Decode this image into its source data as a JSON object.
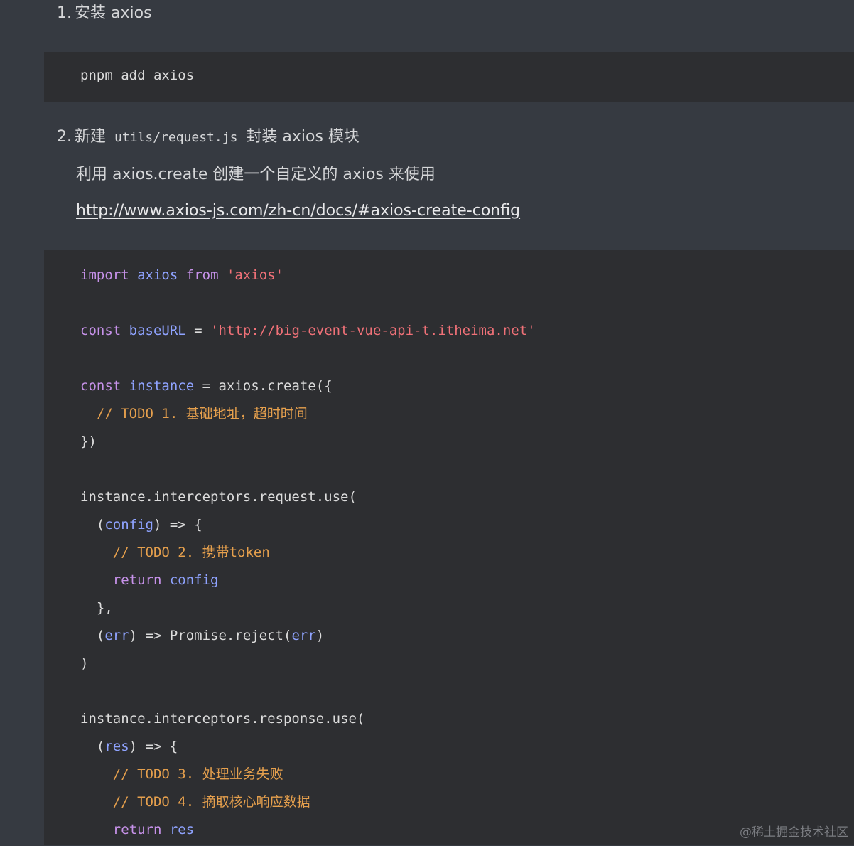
{
  "steps": [
    {
      "number": "1.",
      "text": "安装 axios"
    },
    {
      "number": "2.",
      "text_before": "新建",
      "code": "utils/request.js",
      "text_after": "封装 axios 模块"
    }
  ],
  "install_command": "pnpm add axios",
  "description": "利用 axios.create 创建一个自定义的 axios 来使用",
  "doc_link": "http://www.axios-js.com/zh-cn/docs/#axios-create-config",
  "code_lines": [
    [
      {
        "t": "import",
        "c": "kw"
      },
      {
        "t": " ",
        "c": "pl"
      },
      {
        "t": "axios",
        "c": "id"
      },
      {
        "t": " ",
        "c": "pl"
      },
      {
        "t": "from",
        "c": "kw"
      },
      {
        "t": " ",
        "c": "pl"
      },
      {
        "t": "'axios'",
        "c": "str"
      }
    ],
    [],
    [
      {
        "t": "const",
        "c": "kw"
      },
      {
        "t": " ",
        "c": "pl"
      },
      {
        "t": "baseURL",
        "c": "id"
      },
      {
        "t": " = ",
        "c": "pl"
      },
      {
        "t": "'http://big-event-vue-api-t.itheima.net'",
        "c": "str"
      }
    ],
    [],
    [
      {
        "t": "const",
        "c": "kw"
      },
      {
        "t": " ",
        "c": "pl"
      },
      {
        "t": "instance",
        "c": "id"
      },
      {
        "t": " = axios.create({",
        "c": "pl"
      }
    ],
    [
      {
        "t": "  // TODO 1. 基础地址，超时时间",
        "c": "cm"
      }
    ],
    [
      {
        "t": "})",
        "c": "pl"
      }
    ],
    [],
    [
      {
        "t": "instance.interceptors.request.use(",
        "c": "pl"
      }
    ],
    [
      {
        "t": "  (",
        "c": "pl"
      },
      {
        "t": "config",
        "c": "id"
      },
      {
        "t": ") => {",
        "c": "pl"
      }
    ],
    [
      {
        "t": "    // TODO 2. 携带token",
        "c": "cm"
      }
    ],
    [
      {
        "t": "    ",
        "c": "pl"
      },
      {
        "t": "return",
        "c": "kw"
      },
      {
        "t": " ",
        "c": "pl"
      },
      {
        "t": "config",
        "c": "id"
      }
    ],
    [
      {
        "t": "  },",
        "c": "pl"
      }
    ],
    [
      {
        "t": "  (",
        "c": "pl"
      },
      {
        "t": "err",
        "c": "id"
      },
      {
        "t": ") => Promise.reject(",
        "c": "pl"
      },
      {
        "t": "err",
        "c": "id"
      },
      {
        "t": ")",
        "c": "pl"
      }
    ],
    [
      {
        "t": ")",
        "c": "pl"
      }
    ],
    [],
    [
      {
        "t": "instance.interceptors.response.use(",
        "c": "pl"
      }
    ],
    [
      {
        "t": "  (",
        "c": "pl"
      },
      {
        "t": "res",
        "c": "id"
      },
      {
        "t": ") => {",
        "c": "pl"
      }
    ],
    [
      {
        "t": "    // TODO 3. 处理业务失败",
        "c": "cm"
      }
    ],
    [
      {
        "t": "    // TODO 4. 摘取核心响应数据",
        "c": "cm"
      }
    ],
    [
      {
        "t": "    ",
        "c": "pl"
      },
      {
        "t": "return",
        "c": "kw"
      },
      {
        "t": " ",
        "c": "pl"
      },
      {
        "t": "res",
        "c": "id"
      }
    ]
  ],
  "watermark": "@稀土掘金技术社区",
  "colors": {
    "background": "#363a41",
    "code_background": "#2d2e31",
    "keyword": "#c792ea",
    "identifier": "#8fa3ff",
    "string": "#f07178",
    "comment": "#e6a04d"
  }
}
